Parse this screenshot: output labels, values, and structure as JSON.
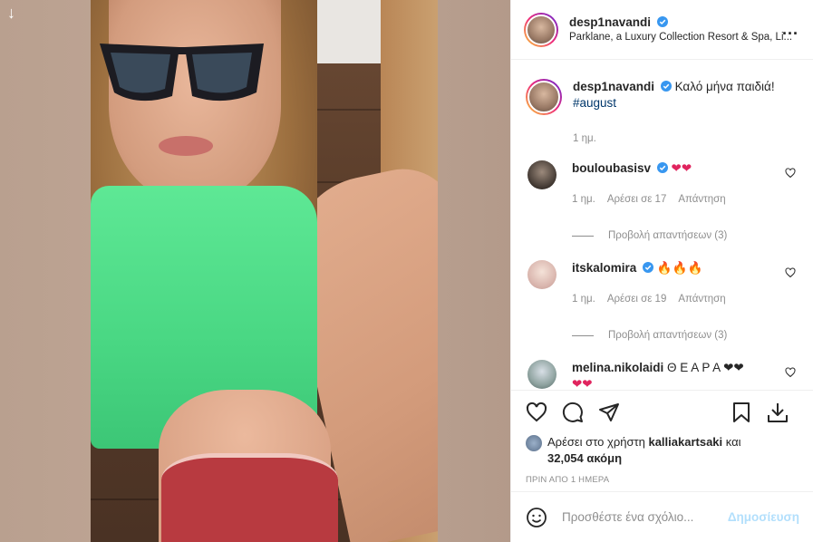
{
  "media": {
    "download_icon": "arrow-down-icon"
  },
  "header": {
    "username": "desp1navandi",
    "location": "Parklane, a Luxury Collection Resort & Spa, Li...",
    "more_icon": "more-horizontal-icon",
    "more_label": "..."
  },
  "caption": {
    "username": "desp1navandi",
    "text": "Καλό μήνα παιδιά!",
    "hashtag": "#august",
    "time": "1 ημ."
  },
  "comments": [
    {
      "username": "bouloubasisv",
      "verified": true,
      "text": "❤❤",
      "time": "1 ημ.",
      "likes": "Αρέσει σε 17",
      "reply": "Απάντηση",
      "view_replies": "Προβολή απαντήσεων (3)"
    },
    {
      "username": "itskalomira",
      "verified": true,
      "text": "🔥🔥🔥",
      "time": "1 ημ.",
      "likes": "Αρέσει σε 19",
      "reply": "Απάντηση",
      "view_replies": "Προβολή απαντήσεων (3)"
    },
    {
      "username": "melina.nikolaidi",
      "verified": false,
      "text": "Θ Ε Α Ρ Α ❤❤",
      "text2": "❤❤"
    }
  ],
  "actions": {
    "like_icon": "heart-icon",
    "comment_icon": "comment-icon",
    "share_icon": "share-icon",
    "save_icon": "bookmark-icon",
    "download_icon": "download-icon"
  },
  "likes": {
    "prefix": "Αρέσει στο χρήστη",
    "user": "kalliakartsaki",
    "middle": "και",
    "count": "32,054 ακόμη"
  },
  "time_ago": "ΠΡΙΝ ΑΠΟ 1 ΗΜΕΡΑ",
  "add_comment": {
    "placeholder": "Προσθέστε ένα σχόλιο...",
    "post_label": "Δημοσίευση",
    "emoji_icon": "emoji-icon"
  },
  "colors": {
    "link": "#00376b",
    "post_disabled": "#b2dffc",
    "verified": "#3897f0",
    "heart": "#e0245e"
  }
}
